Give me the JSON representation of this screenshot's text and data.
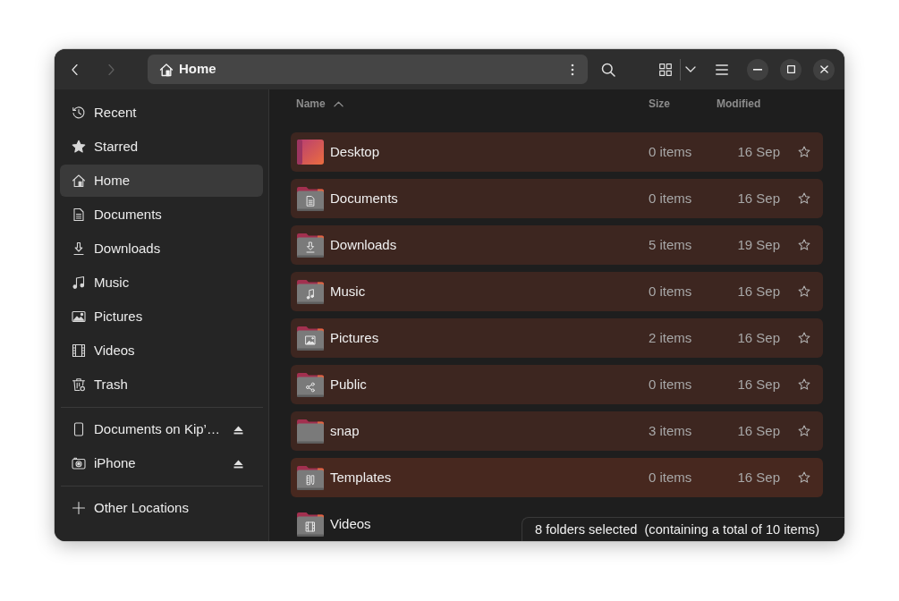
{
  "header": {
    "nav": [
      {
        "kind": "back",
        "disabled": false
      },
      {
        "kind": "forward",
        "disabled": true
      }
    ],
    "path": {
      "label": "Home"
    }
  },
  "sidebar": {
    "places": [
      {
        "label": "Recent",
        "kind": "recent",
        "selected": false
      },
      {
        "label": "Starred",
        "kind": "starred",
        "selected": false
      },
      {
        "label": "Home",
        "kind": "home",
        "selected": true
      },
      {
        "label": "Documents",
        "kind": "documents",
        "selected": false
      },
      {
        "label": "Downloads",
        "kind": "downloads",
        "selected": false
      },
      {
        "label": "Music",
        "kind": "music",
        "selected": false
      },
      {
        "label": "Pictures",
        "kind": "pictures",
        "selected": false
      },
      {
        "label": "Videos",
        "kind": "videos",
        "selected": false
      },
      {
        "label": "Trash",
        "kind": "trash",
        "selected": false
      }
    ],
    "devices": [
      {
        "label": "Documents on Kip’…",
        "kind": "phone",
        "selected": false
      },
      {
        "label": "iPhone",
        "kind": "camera",
        "selected": false
      }
    ],
    "other": [
      {
        "label": "Other Locations",
        "kind": "add",
        "selected": false
      }
    ]
  },
  "files": {
    "columns": [
      {
        "label": "Name",
        "sorted_ascending": true
      },
      {
        "label": "Size"
      },
      {
        "label": "Modified"
      }
    ],
    "rows": [
      {
        "name": "Desktop",
        "kind": "desktop",
        "size": "0 items",
        "modified": "16 Sep",
        "starred": false,
        "selected": true,
        "hovered": false
      },
      {
        "name": "Documents",
        "kind": "documents",
        "size": "0 items",
        "modified": "16 Sep",
        "starred": false,
        "selected": true,
        "hovered": false
      },
      {
        "name": "Downloads",
        "kind": "downloads",
        "size": "5 items",
        "modified": "19 Sep",
        "starred": false,
        "selected": true,
        "hovered": false
      },
      {
        "name": "Music",
        "kind": "music",
        "size": "0 items",
        "modified": "16 Sep",
        "starred": false,
        "selected": true,
        "hovered": false
      },
      {
        "name": "Pictures",
        "kind": "pictures",
        "size": "2 items",
        "modified": "16 Sep",
        "starred": false,
        "selected": true,
        "hovered": false
      },
      {
        "name": "Public",
        "kind": "public",
        "size": "0 items",
        "modified": "16 Sep",
        "starred": false,
        "selected": true,
        "hovered": false
      },
      {
        "name": "snap",
        "kind": "plain",
        "size": "3 items",
        "modified": "16 Sep",
        "starred": false,
        "selected": true,
        "hovered": false
      },
      {
        "name": "Templates",
        "kind": "templates",
        "size": "0 items",
        "modified": "16 Sep",
        "starred": false,
        "selected": true,
        "hovered": true
      },
      {
        "name": "Videos",
        "kind": "videos",
        "selected": false,
        "hovered": false
      }
    ]
  },
  "status_bar": {
    "text": "8 folders selected  (containing a total of 10 items)"
  }
}
